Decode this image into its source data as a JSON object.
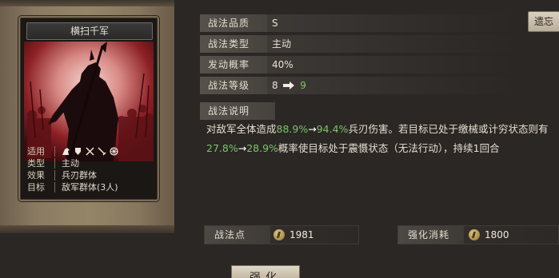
{
  "card": {
    "title": "横扫千军",
    "info": [
      {
        "key": "适用",
        "value": ""
      },
      {
        "key": "类型",
        "value": "主动"
      },
      {
        "key": "效果",
        "value": "兵刃群体"
      },
      {
        "key": "目标",
        "value": "敌军群体(3人)"
      }
    ],
    "applicable_icons": [
      "cavalry-icon",
      "shield-icon",
      "bow-icon",
      "spear-icon",
      "wheel-icon"
    ]
  },
  "attributes": {
    "quality_label": "战法品质",
    "quality_value": "S",
    "type_label": "战法类型",
    "type_value": "主动",
    "rate_label": "发动概率",
    "rate_value": "40%",
    "level_label": "战法等级",
    "level_from": "8",
    "level_to": "9"
  },
  "detail_button": "遗忘",
  "description": {
    "title": "战法说明",
    "t1": "对敌军全体造成",
    "v1": "88.9%",
    "a1": "→",
    "v2": "94.4%",
    "t2": "兵刃伤害。若目标已处于缴械或计穷状态则有",
    "v3": "27.8%",
    "a2": "→",
    "v4": "28.9%",
    "t3": "概率使目标处于震慑状态（无法行动），持续1回合"
  },
  "bottom": {
    "points_label": "战法点",
    "points_value": "1981",
    "cost_label": "强化消耗",
    "cost_value": "1800"
  },
  "confirm_button": "强化",
  "colors": {
    "highlight_green": "#7fc36b",
    "panel_bg": "#2a2724"
  }
}
